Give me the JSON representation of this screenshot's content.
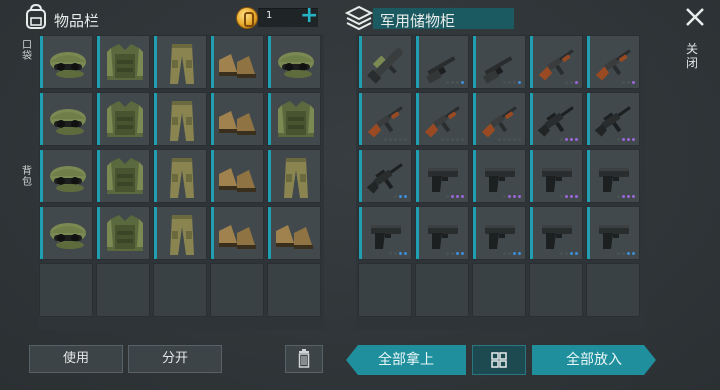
{
  "inventory": {
    "title": "物品栏",
    "pocket_label": "口袋",
    "backpack_label": "背包",
    "coins": "1",
    "rows": [
      [
        "cap-icon",
        "vest-icon",
        "pants-icon",
        "boots-icon",
        "cap-icon"
      ],
      [
        "cap-icon",
        "vest-icon",
        "pants-icon",
        "boots-icon",
        "vest-icon"
      ],
      [
        "cap-icon",
        "vest-icon",
        "pants-icon",
        "boots-icon",
        "pants-icon"
      ],
      [
        "cap-icon",
        "vest-icon",
        "pants-icon",
        "boots-icon",
        "boots-icon"
      ],
      [
        "",
        "",
        "",
        "",
        ""
      ]
    ]
  },
  "locker": {
    "title": "军用储物柜",
    "rows": [
      [
        "launcher-icon",
        "shotgun-icon",
        "shotgun-icon",
        "rifle-icon",
        "rifle-icon"
      ],
      [
        "rifle-icon",
        "rifle-icon",
        "rifle-icon",
        "black-rifle-icon",
        "black-rifle-icon"
      ],
      [
        "black-rifle-icon",
        "pistol-icon",
        "pistol-icon",
        "pistol-icon",
        "pistol-icon"
      ],
      [
        "pistol-icon",
        "pistol-icon",
        "pistol-icon",
        "pistol-icon",
        "pistol-icon"
      ],
      [
        "",
        "",
        "",
        "",
        ""
      ]
    ],
    "dots": [
      [
        "",
        "g,g,g,b",
        "g,g,g,b",
        "g,g,p",
        "g,g,p"
      ],
      [
        "g,g,g,g,g",
        "g,g,g,g,g",
        "g,g,g,g,g",
        "g,p,p,p",
        "g,p,p,p"
      ],
      [
        "g,b,b",
        "g,p,p,p",
        "g,p,p,p",
        "g,p,p,p",
        "g,p,p,p"
      ],
      [
        "g,g,b,b",
        "g,g,b,b",
        "g,g,b,b",
        "g,g,b,b",
        "g,g,b,b"
      ],
      [
        "",
        "",
        "",
        "",
        ""
      ]
    ]
  },
  "buttons": {
    "use": "使用",
    "split": "分开",
    "take_all": "全部拿上",
    "put_all": "全部放入",
    "close": "关闭"
  },
  "colors": {
    "accent": "#1f9fb1",
    "button_teal": "#1f8f9d"
  }
}
